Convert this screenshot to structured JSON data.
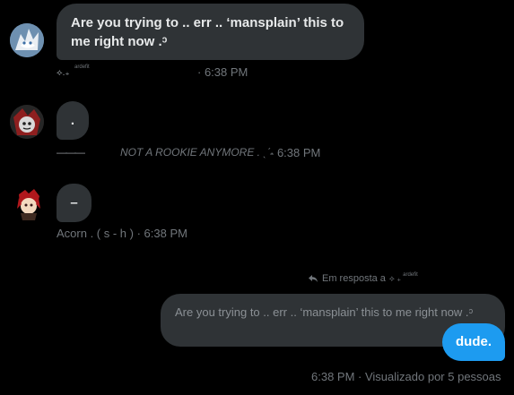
{
  "messages": [
    {
      "text": "Are you trying to  ..  err  ..  ‘mansplain’ this to me right now .ᵓ",
      "sender_prefix": "⟡.₊",
      "sender_sup": "ardefit",
      "time": "· 6:38 PM"
    },
    {
      "text": ".",
      "sender_prefix": "———",
      "sender_name": "NOT A ROOKIE ANYMORE . ˎˊ˗",
      "time": "· 6:38 PM"
    },
    {
      "text": "–",
      "sender_name": "Acorn . ( s - h )",
      "time": "· 6:38 PM"
    }
  ],
  "reply": {
    "label": "Em resposta a",
    "target_prefix": "⟡ ₊",
    "target_sup": "ardefit",
    "quoted_text": "Are you trying to  ..  err  ..  ‘mansplain’ this to me right now .ᵓ",
    "message": "dude.",
    "time": "6:38 PM",
    "status": "· Visualizado por 5 pessoas"
  },
  "colors": {
    "background": "#000000",
    "bubble": "#2f3336",
    "sent_bubble": "#1d9bf0",
    "muted_text": "#71767b",
    "text": "#e7e9ea"
  },
  "icons": {
    "reply": "reply-arrow-icon",
    "avatars": [
      "avatar-white-character",
      "avatar-red-black-character",
      "avatar-red-hair-character"
    ]
  }
}
